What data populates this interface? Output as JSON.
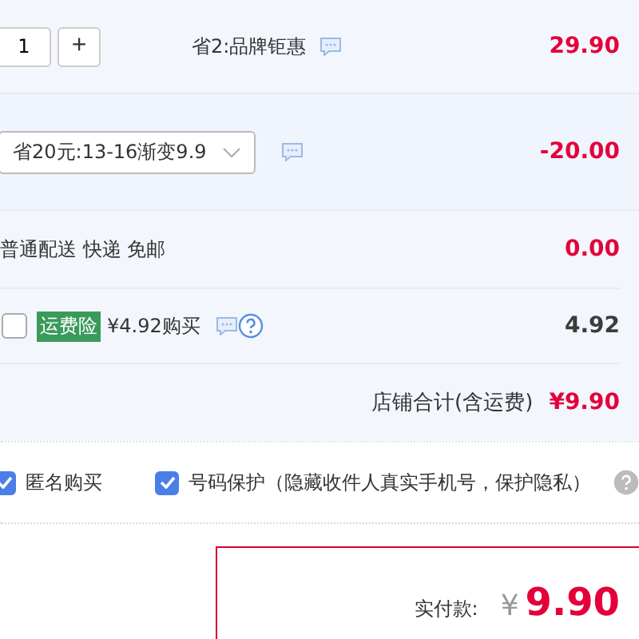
{
  "item_row": {
    "quantity": "1",
    "increase": "+",
    "promotion": "省2:品牌钜惠",
    "price": "29.90"
  },
  "coupon_row": {
    "selected_coupon": "省20元:13-16渐变9.9",
    "amount": "-20.00"
  },
  "shipping_row": {
    "method": "普通配送 快递 免邮",
    "amount": "0.00"
  },
  "insurance_row": {
    "checked": false,
    "tag": "运费险",
    "offer": "¥4.92购买",
    "amount": "4.92"
  },
  "store_total": {
    "label": "店铺合计(含运费)",
    "amount": "¥9.90"
  },
  "options": [
    {
      "label": "匿名购买",
      "checked": true,
      "help": false
    },
    {
      "label": "号码保护（隐藏收件人真实手机号，保护隐私）",
      "checked": true,
      "help": true
    }
  ],
  "payment": {
    "label": "实付款:",
    "currency": "¥",
    "amount": "9.90"
  }
}
